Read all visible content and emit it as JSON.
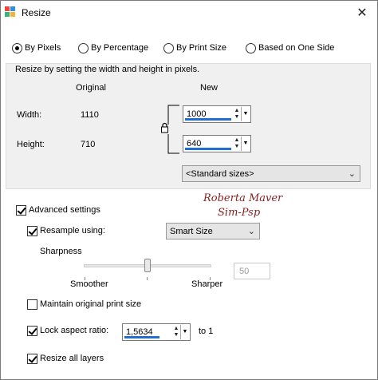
{
  "window": {
    "title": "Resize"
  },
  "modes": [
    {
      "label": "By Pixels",
      "selected": true
    },
    {
      "label": "By Percentage",
      "selected": false
    },
    {
      "label": "By Print Size",
      "selected": false
    },
    {
      "label": "Based on One Side",
      "selected": false
    }
  ],
  "group": {
    "caption": "Resize by setting the width and height in pixels.",
    "original_header": "Original",
    "new_header": "New",
    "width_label": "Width:",
    "width_original": "1110",
    "width_new": "1000",
    "height_label": "Height:",
    "height_original": "710",
    "height_new": "640",
    "standard_sizes": "<Standard sizes>"
  },
  "advanced": {
    "label": "Advanced settings",
    "checked": true,
    "resample_label": "Resample using:",
    "resample_checked": true,
    "resample_value": "Smart Size",
    "sharpness_label": "Sharpness",
    "smoother_label": "Smoother",
    "sharper_label": "Sharper",
    "sharpness_value": "50",
    "maintain_print_label": "Maintain original print size",
    "maintain_print_checked": false,
    "lock_aspect_label": "Lock aspect ratio:",
    "lock_aspect_checked": true,
    "aspect_value": "1,5634",
    "aspect_suffix": "to 1",
    "resize_layers_label": "Resize all layers",
    "resize_layers_checked": true
  },
  "watermark": {
    "line1": "Roberta Maver",
    "line2": "Sim-Psp"
  },
  "colors": {
    "accent": "#1f6fcf",
    "group_bg": "#f0f0f0",
    "watermark": "#8a1e1e"
  }
}
